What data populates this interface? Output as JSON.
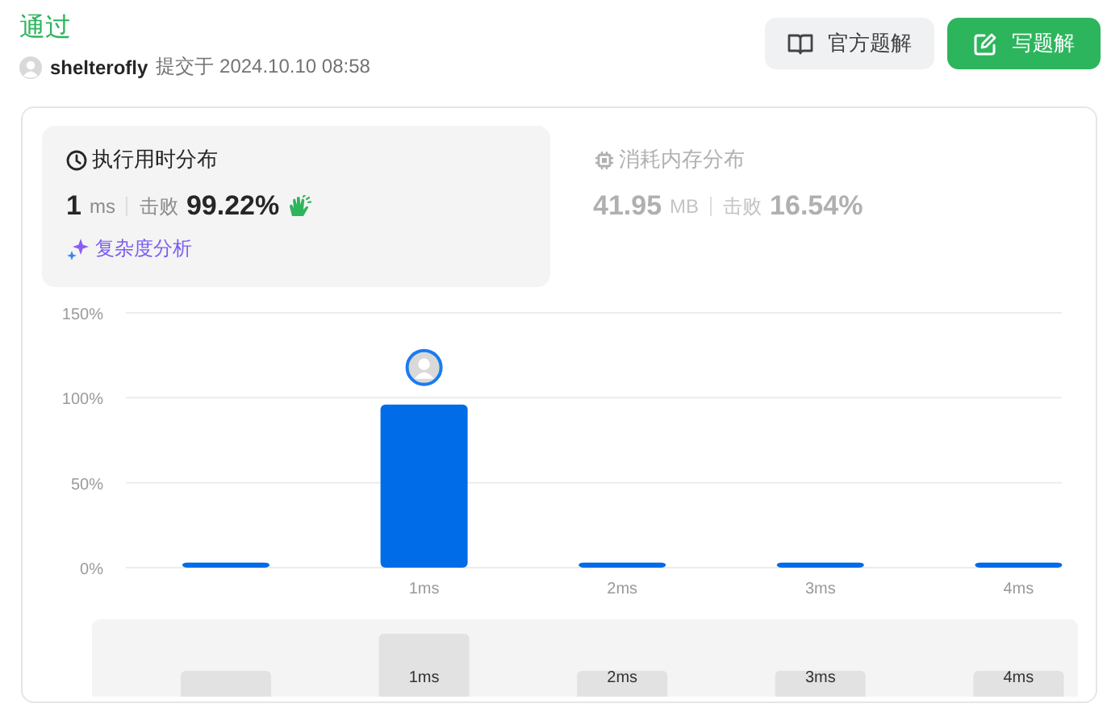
{
  "status": {
    "label": "通过"
  },
  "submission": {
    "user": "shelterofly",
    "submitted": "提交于 2024.10.10 08:58"
  },
  "buttons": [
    {
      "kind": "solutions",
      "label": "官方题解"
    },
    {
      "kind": "write",
      "label": "写题解"
    }
  ],
  "tabs": [
    {
      "kind": "runtime",
      "title": "执行用时分布",
      "selected": true,
      "value": "1",
      "unit": "ms",
      "beats_label": "击败",
      "beats": "99.22%",
      "analysis": "复杂度分析"
    },
    {
      "kind": "memory",
      "title": "消耗内存分布",
      "selected": false,
      "value": "41.95",
      "unit": "MB",
      "beats_label": "击败",
      "beats": "16.54%"
    }
  ],
  "chart_data": {
    "type": "bar",
    "categories": [
      null,
      "1ms",
      "2ms",
      "3ms",
      "4ms"
    ],
    "series": [
      {
        "color": "#006ce8",
        "values": [
          3,
          96,
          3,
          3,
          3
        ]
      }
    ],
    "ylim": [
      0,
      150
    ],
    "yticks": [
      {
        "value": 0,
        "label": "0%"
      },
      {
        "value": 50,
        "label": "50%"
      },
      {
        "value": 100,
        "label": "100%"
      },
      {
        "value": 150,
        "label": "150%"
      }
    ]
  },
  "bins": [
    {
      "selected": false
    },
    {
      "selected": true
    },
    {
      "selected": false
    },
    {
      "selected": false
    },
    {
      "selected": false
    }
  ],
  "overview": {
    "labels": [
      "1ms",
      "2ms",
      "3ms",
      "4ms"
    ]
  }
}
